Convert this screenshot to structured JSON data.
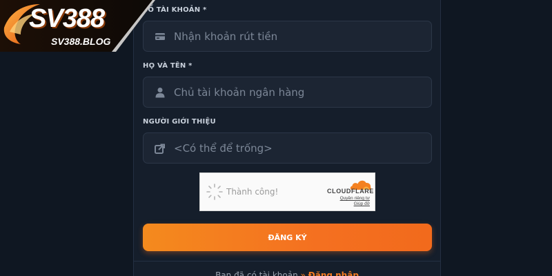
{
  "brand": {
    "logo_text": "SV388",
    "logo_sub": "SV388.BLOG"
  },
  "form": {
    "account_label": "SỐ TÀI KHOẢN *",
    "account_placeholder": "Nhận khoản rút tiền",
    "name_label": "HỌ VÀ TÊN *",
    "name_placeholder": "Chủ tài khoản ngân hàng",
    "referrer_label": "NGƯỜI GIỚI THIỆU",
    "referrer_placeholder": "<Có thể để trống>",
    "submit_label": "ĐĂNG KÝ"
  },
  "captcha": {
    "status": "Thành công!",
    "brand": "CLOUDFLARE",
    "privacy_link": "Quyền riêng tư",
    "help_link": "Giúp đỡ"
  },
  "footer": {
    "prompt": "Bạn đã có tài khoản",
    "arrow": "»",
    "login_link": "Đăng nhập"
  },
  "colors": {
    "accent": "#f47a20",
    "background": "#0f1722",
    "panel": "#151e2b",
    "field": "#1c2533"
  }
}
